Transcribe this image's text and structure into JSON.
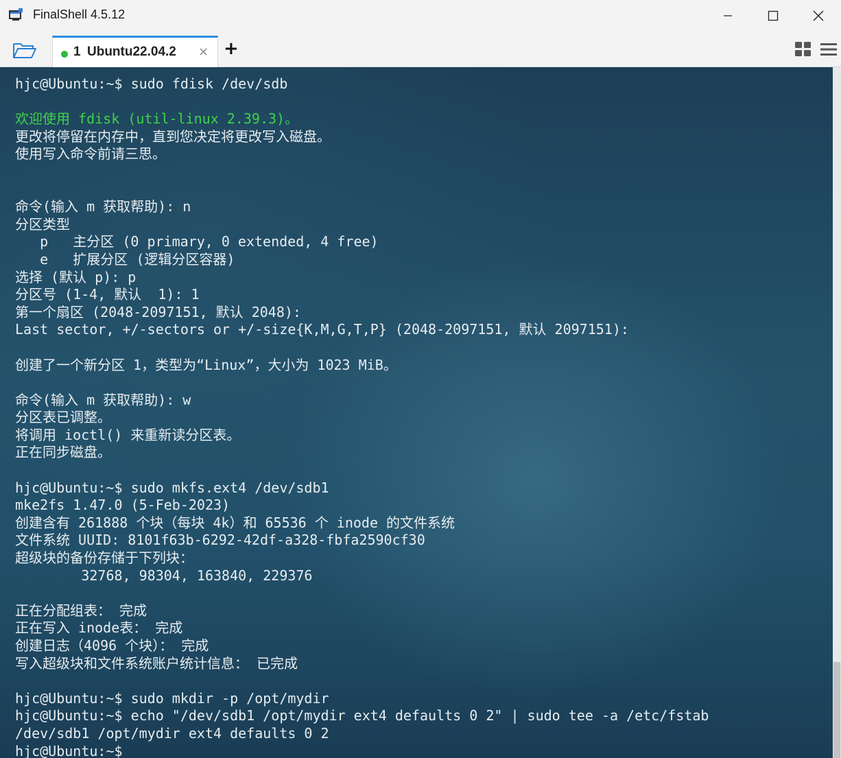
{
  "window": {
    "title": "FinalShell 4.5.12",
    "icons": [
      "app-icon",
      "minimize-icon",
      "maximize-icon",
      "close-icon"
    ]
  },
  "tabbar": {
    "tabs": [
      {
        "index": "1",
        "label": "Ubuntu22.04.2",
        "status": "connected",
        "close": "×"
      }
    ],
    "add_label": "+",
    "icons": [
      "folder-open-icon",
      "layout-grid-icon",
      "hamburger-menu-icon"
    ]
  },
  "colors": {
    "accent": "#2a8ce0",
    "status_connected": "#2dbb3a",
    "terminal_highlight": "#3fd24a",
    "terminal_text": "#e6ecef"
  },
  "terminal": {
    "lines": [
      {
        "text": "hjc@Ubuntu:~$ sudo fdisk /dev/sdb",
        "style": ""
      },
      {
        "text": "",
        "style": ""
      },
      {
        "text": "欢迎使用 fdisk (util-linux 2.39.3)。",
        "style": "green"
      },
      {
        "text": "更改将停留在内存中，直到您决定将更改写入磁盘。",
        "style": ""
      },
      {
        "text": "使用写入命令前请三思。",
        "style": ""
      },
      {
        "text": "",
        "style": ""
      },
      {
        "text": "",
        "style": ""
      },
      {
        "text": "命令(输入 m 获取帮助): n",
        "style": ""
      },
      {
        "text": "分区类型",
        "style": ""
      },
      {
        "text": "   p   主分区 (0 primary, 0 extended, 4 free)",
        "style": ""
      },
      {
        "text": "   e   扩展分区 (逻辑分区容器)",
        "style": ""
      },
      {
        "text": "选择 (默认 p): p",
        "style": ""
      },
      {
        "text": "分区号 (1-4, 默认  1): 1",
        "style": ""
      },
      {
        "text": "第一个扇区 (2048-2097151, 默认 2048):",
        "style": ""
      },
      {
        "text": "Last sector, +/-sectors or +/-size{K,M,G,T,P} (2048-2097151, 默认 2097151):",
        "style": ""
      },
      {
        "text": "",
        "style": ""
      },
      {
        "text": "创建了一个新分区 1，类型为“Linux”，大小为 1023 MiB。",
        "style": ""
      },
      {
        "text": "",
        "style": ""
      },
      {
        "text": "命令(输入 m 获取帮助): w",
        "style": ""
      },
      {
        "text": "分区表已调整。",
        "style": ""
      },
      {
        "text": "将调用 ioctl() 来重新读分区表。",
        "style": ""
      },
      {
        "text": "正在同步磁盘。",
        "style": ""
      },
      {
        "text": "",
        "style": ""
      },
      {
        "text": "hjc@Ubuntu:~$ sudo mkfs.ext4 /dev/sdb1",
        "style": ""
      },
      {
        "text": "mke2fs 1.47.0 (5-Feb-2023)",
        "style": ""
      },
      {
        "text": "创建含有 261888 个块（每块 4k）和 65536 个 inode 的文件系统",
        "style": ""
      },
      {
        "text": "文件系统 UUID: 8101f63b-6292-42df-a328-fbfa2590cf30",
        "style": ""
      },
      {
        "text": "超级块的备份存储于下列块：",
        "style": ""
      },
      {
        "text": "        32768, 98304, 163840, 229376",
        "style": ""
      },
      {
        "text": "",
        "style": ""
      },
      {
        "text": "正在分配组表： 完成",
        "style": ""
      },
      {
        "text": "正在写入 inode表： 完成",
        "style": ""
      },
      {
        "text": "创建日志（4096 个块）： 完成",
        "style": ""
      },
      {
        "text": "写入超级块和文件系统账户统计信息： 已完成",
        "style": ""
      },
      {
        "text": "",
        "style": ""
      },
      {
        "text": "hjc@Ubuntu:~$ sudo mkdir -p /opt/mydir",
        "style": ""
      },
      {
        "text": "hjc@Ubuntu:~$ echo \"/dev/sdb1 /opt/mydir ext4 defaults 0 2\" | sudo tee -a /etc/fstab",
        "style": ""
      },
      {
        "text": "/dev/sdb1 /opt/mydir ext4 defaults 0 2",
        "style": ""
      },
      {
        "text": "hjc@Ubuntu:~$",
        "style": ""
      }
    ]
  }
}
